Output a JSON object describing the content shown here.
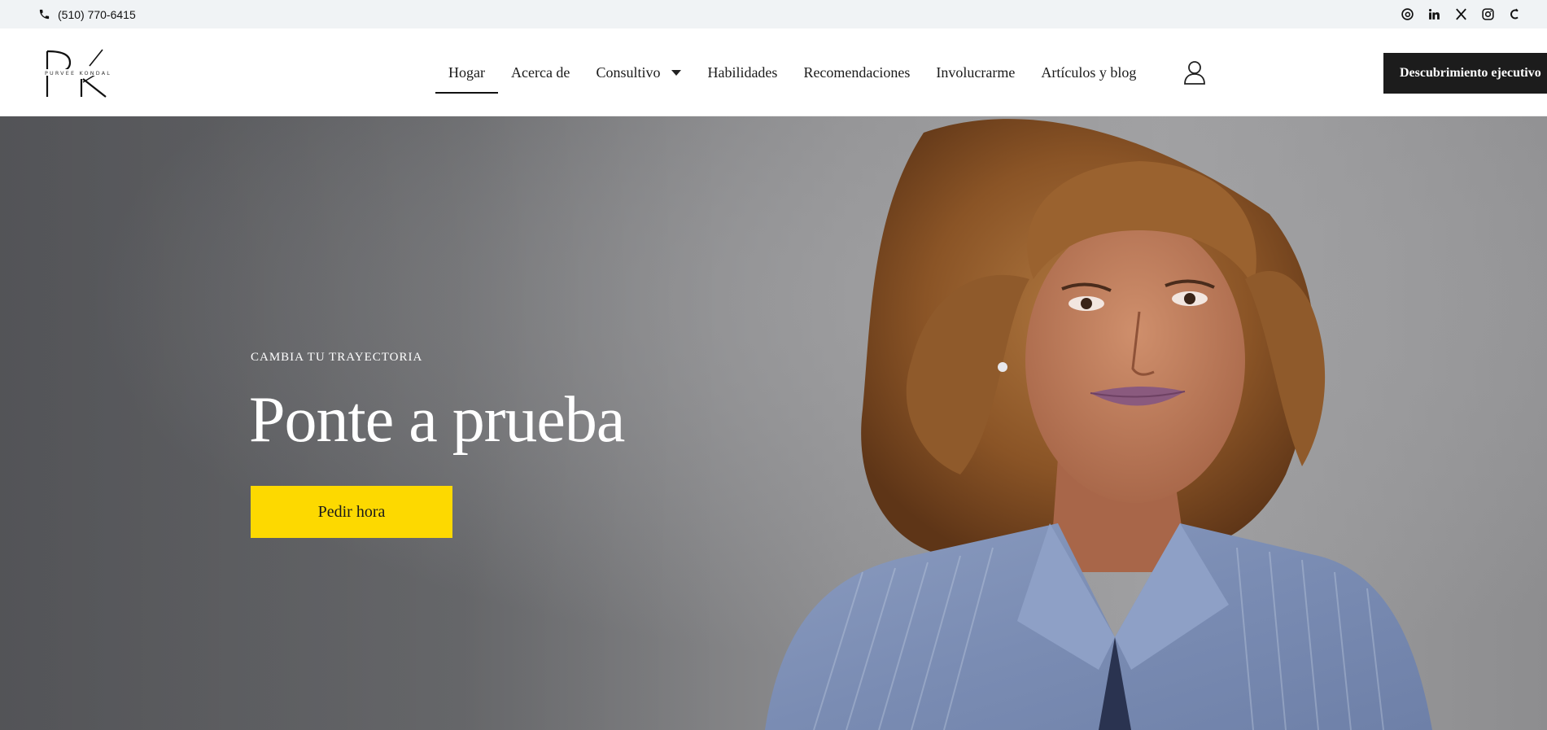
{
  "topbar": {
    "phone": "(510) 770-6415",
    "icons": [
      "phone-icon",
      "threads-icon",
      "linkedin-icon",
      "x-twitter-icon",
      "instagram-icon",
      "custom-c-icon"
    ]
  },
  "header": {
    "logo": {
      "monogram": "PK",
      "name": "PURVEE KONDAL"
    },
    "nav": [
      {
        "label": "Hogar",
        "active": true
      },
      {
        "label": "Acerca de"
      },
      {
        "label": "Consultivo",
        "dropdown": true
      },
      {
        "label": "Habilidades"
      },
      {
        "label": "Recomendaciones"
      },
      {
        "label": "Involucrarme"
      },
      {
        "label": "Artículos y blog"
      }
    ],
    "cta": "Descubrimiento ejecutivo"
  },
  "hero": {
    "eyebrow": "CAMBIA TU TRAYECTORIA",
    "title": "Ponte a prueba",
    "button": "Pedir hora"
  },
  "colors": {
    "accent_yellow": "#fdd900",
    "dark": "#1c1c1c",
    "topbar_bg": "#f0f3f5"
  }
}
